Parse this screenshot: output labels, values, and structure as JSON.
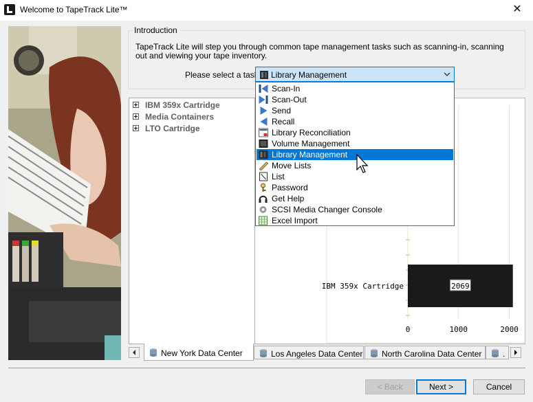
{
  "window": {
    "title": "Welcome to TapeTrack Lite™",
    "close_label": "✕"
  },
  "intro": {
    "legend": "Introduction",
    "text": "TapeTrack Lite will step you through common tape management tasks such as scanning-in, scanning out and viewing your tape inventory.",
    "task_label": "Please select a task",
    "selected_task": "Library Management"
  },
  "task_options": [
    {
      "label": "Scan-In",
      "icon": "scan-in-icon"
    },
    {
      "label": "Scan-Out",
      "icon": "scan-out-icon"
    },
    {
      "label": "Send",
      "icon": "send-icon"
    },
    {
      "label": "Recall",
      "icon": "recall-icon"
    },
    {
      "label": "Library Reconciliation",
      "icon": "reconciliation-icon"
    },
    {
      "label": "Volume Management",
      "icon": "volume-icon"
    },
    {
      "label": "Library Management",
      "icon": "library-icon",
      "selected": true
    },
    {
      "label": "Move Lists",
      "icon": "move-lists-icon"
    },
    {
      "label": "List",
      "icon": "list-icon"
    },
    {
      "label": "Password",
      "icon": "password-icon"
    },
    {
      "label": "Get Help",
      "icon": "help-headset-icon"
    },
    {
      "label": "SCSI Media Changer Console",
      "icon": "gear-icon"
    },
    {
      "label": "Excel Import",
      "icon": "excel-icon"
    }
  ],
  "tree": {
    "items": [
      {
        "label": "IBM 359x Cartridge"
      },
      {
        "label": "Media Containers"
      },
      {
        "label": "LTO Cartridge"
      }
    ]
  },
  "chart_data": {
    "type": "bar",
    "orientation": "horizontal",
    "categories": [
      "IBM 359x Cartridge"
    ],
    "values": [
      2069
    ],
    "data_labels": [
      "2069"
    ],
    "x_ticks": [
      "0",
      "1000",
      "2000"
    ],
    "xlim": [
      0,
      2100
    ],
    "grid": true,
    "bar_color": "#1a1a1a"
  },
  "tabs": [
    {
      "label": "New York Data Center",
      "active": true
    },
    {
      "label": "Los Angeles Data Center"
    },
    {
      "label": "North Carolina Data Center"
    },
    {
      "label": "."
    }
  ],
  "buttons": {
    "back": "< Back",
    "next": "Next >",
    "cancel": "Cancel"
  },
  "colors": {
    "accent": "#0078d7",
    "selection_bg": "#cce4f7"
  }
}
